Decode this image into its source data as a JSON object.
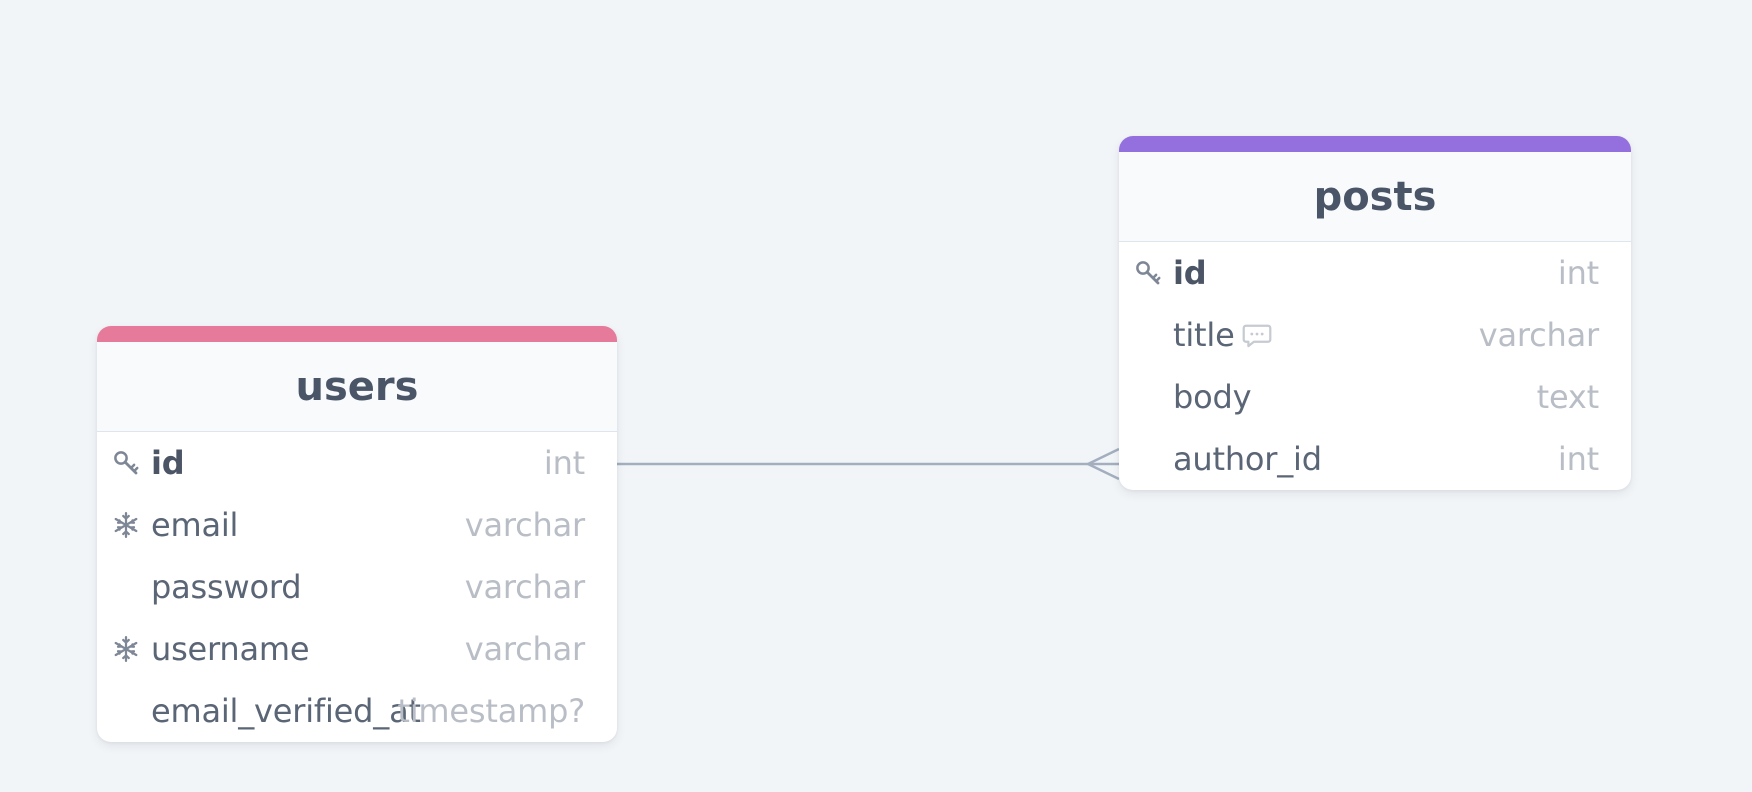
{
  "diagram": {
    "relation_color": "#a3afbf",
    "tables": {
      "users": {
        "name": "users",
        "accent": "#e57a9a",
        "columns": [
          {
            "name": "id",
            "type": "int",
            "icon": "key-icon",
            "primary": true
          },
          {
            "name": "email",
            "type": "varchar",
            "icon": "snowflake-icon",
            "primary": false
          },
          {
            "name": "password",
            "type": "varchar",
            "icon": "",
            "primary": false
          },
          {
            "name": "username",
            "type": "varchar",
            "icon": "snowflake-icon",
            "primary": false
          },
          {
            "name": "email_verified_at",
            "type": "timestamp?",
            "icon": "",
            "primary": false
          }
        ]
      },
      "posts": {
        "name": "posts",
        "accent": "#9370dd",
        "columns": [
          {
            "name": "id",
            "type": "int",
            "icon": "key-icon",
            "primary": true
          },
          {
            "name": "title",
            "type": "varchar",
            "icon": "comment-icon",
            "primary": false
          },
          {
            "name": "body",
            "type": "text",
            "icon": "",
            "primary": false
          },
          {
            "name": "author_id",
            "type": "int",
            "icon": "",
            "primary": false
          }
        ]
      }
    },
    "relations": [
      {
        "from": "users.id",
        "to": "posts.author_id",
        "cardinality": "one-to-many"
      }
    ]
  }
}
